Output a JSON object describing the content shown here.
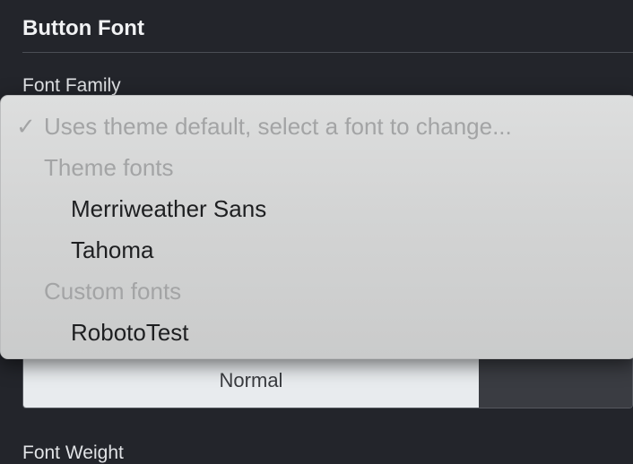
{
  "section": {
    "title": "Button Font",
    "font_family_label": "Font Family",
    "font_weight_label": "Font Weight"
  },
  "font_style": {
    "selected_option": "Normal",
    "other_option": ""
  },
  "dropdown": {
    "placeholder_option": "Uses theme default, select a font to change...",
    "check_icon": "checkmark-icon",
    "groups": [
      {
        "header": "Theme fonts",
        "items": [
          "Merriweather Sans",
          "Tahoma"
        ]
      },
      {
        "header": "Custom fonts",
        "items": [
          "RobotoTest"
        ]
      }
    ]
  },
  "colors": {
    "background": "#23252b",
    "menu_background": "#d6d7d7",
    "disabled_text": "#a3a4a5",
    "option_text": "#1e1f21",
    "selected_segment": "#e8ebee"
  }
}
